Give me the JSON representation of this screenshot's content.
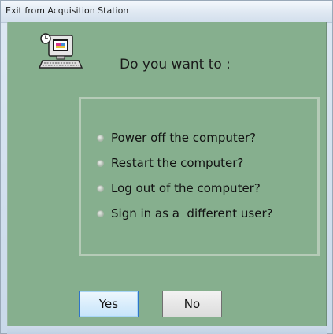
{
  "window": {
    "title": "Exit from Acquisition Station"
  },
  "dialog": {
    "icon": "computer-icon",
    "question": "Do you want to :",
    "options": [
      {
        "label": "Power off the computer?",
        "selected": false
      },
      {
        "label": "Restart the computer?",
        "selected": false
      },
      {
        "label": "Log out of the computer?",
        "selected": false
      },
      {
        "label": "Sign in as a  different user?",
        "selected": false
      }
    ],
    "buttons": {
      "yes_label": "Yes",
      "no_label": "No"
    }
  },
  "colors": {
    "panel": "#86af8e",
    "group_border": "#b5cbb7",
    "focused_button_border": "#2f74c9"
  }
}
